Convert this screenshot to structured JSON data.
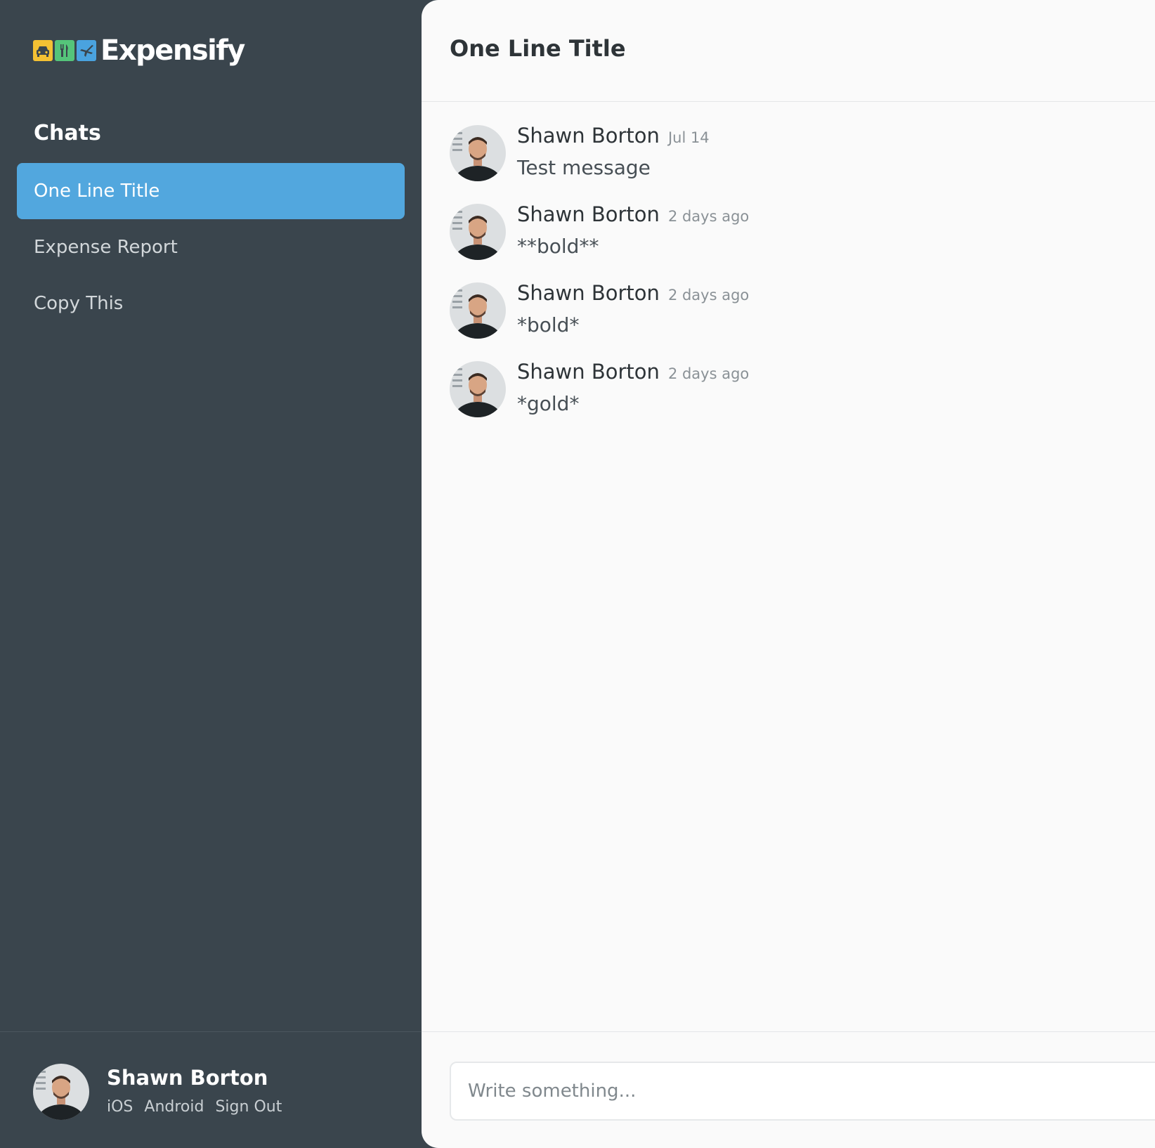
{
  "app": {
    "brand": "Expensify",
    "colors": {
      "sidebar_bg": "#3a454d",
      "active_item": "#52a7de",
      "main_bg": "#fafafa",
      "logo_tile_1": "#f4c133",
      "logo_tile_2": "#55c47a",
      "logo_tile_3": "#4aa3df"
    },
    "logo_icons": [
      "car-icon",
      "fork-knife-icon",
      "airplane-icon"
    ]
  },
  "sidebar": {
    "heading": "Chats",
    "items": [
      {
        "label": "One Line Title",
        "active": true
      },
      {
        "label": "Expense Report",
        "active": false
      },
      {
        "label": "Copy This",
        "active": false
      }
    ],
    "user": {
      "name": "Shawn Borton",
      "links": [
        "iOS",
        "Android",
        "Sign Out"
      ]
    }
  },
  "main": {
    "title": "One Line Title",
    "messages": [
      {
        "author": "Shawn Borton",
        "time": "Jul 14",
        "text": "Test message"
      },
      {
        "author": "Shawn Borton",
        "time": "2 days ago",
        "text": "**bold**"
      },
      {
        "author": "Shawn Borton",
        "time": "2 days ago",
        "text": "*bold*"
      },
      {
        "author": "Shawn Borton",
        "time": "2 days ago",
        "text": "*gold*"
      }
    ],
    "composer": {
      "placeholder": "Write something...",
      "value": ""
    }
  }
}
